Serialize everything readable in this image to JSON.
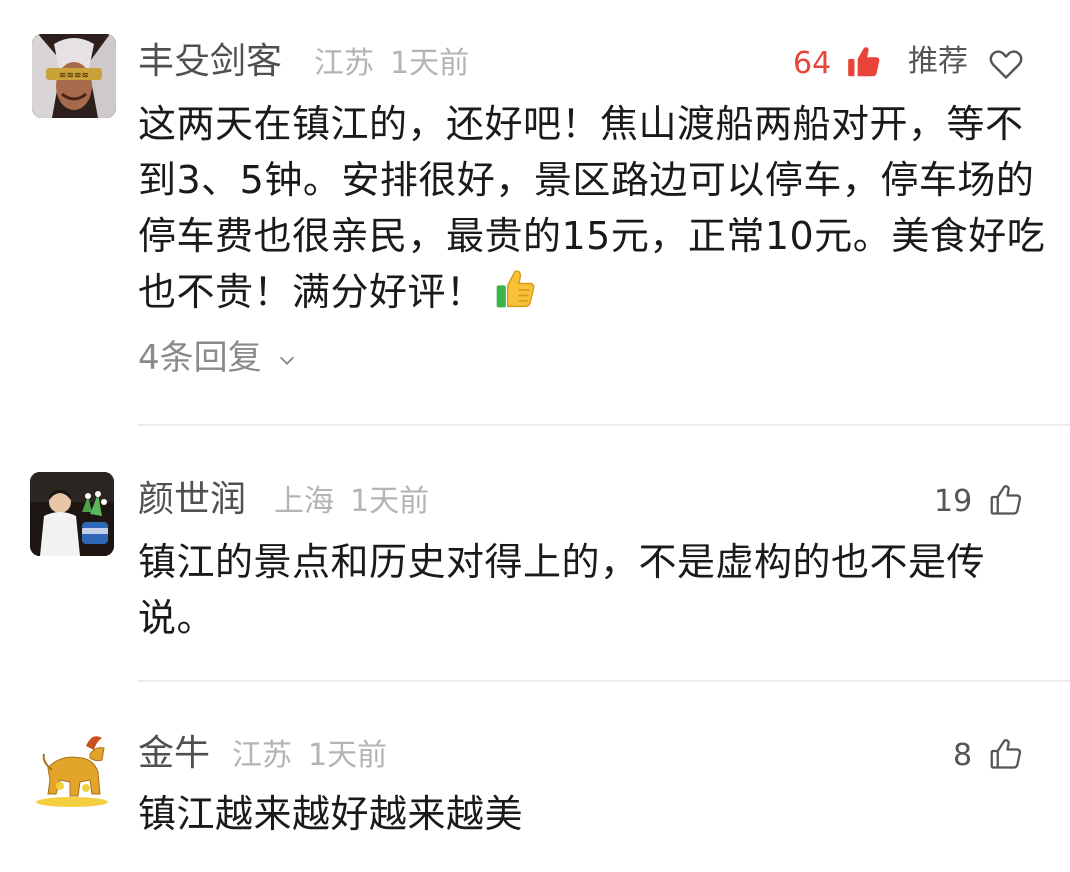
{
  "comments": [
    {
      "author": "丰殳剑客",
      "location": "江苏",
      "time": "1天前",
      "likes": "64",
      "recommend_label": "推荐",
      "content": "这两天在镇江的，还好吧！焦山渡船两船对开，等不到3、5钟。安排很好，景区路边可以停车，停车场的停车费也很亲民，最贵的15元，正常10元。美食好吃也不贵！满分好评！",
      "emoji": "thumbs-up-emoji",
      "replies": "4条回复"
    },
    {
      "author": "颜世润",
      "location": "上海",
      "time": "1天前",
      "likes": "19",
      "content": "镇江的景点和历史对得上的，不是虚构的也不是传说。"
    },
    {
      "author": "金牛",
      "location": "江苏",
      "time": "1天前",
      "likes": "8",
      "content": "镇江越来越好越来越美"
    }
  ],
  "icons": {
    "like_filled": "thumbs-up-filled-icon",
    "like_outline": "thumbs-up-outline-icon",
    "heart": "heart-outline-icon",
    "chevron": "chevron-down-icon"
  },
  "colors": {
    "hot_like": "#e8443a",
    "name": "#505050",
    "meta": "#b4b4b4",
    "body": "#1a1a1a"
  }
}
